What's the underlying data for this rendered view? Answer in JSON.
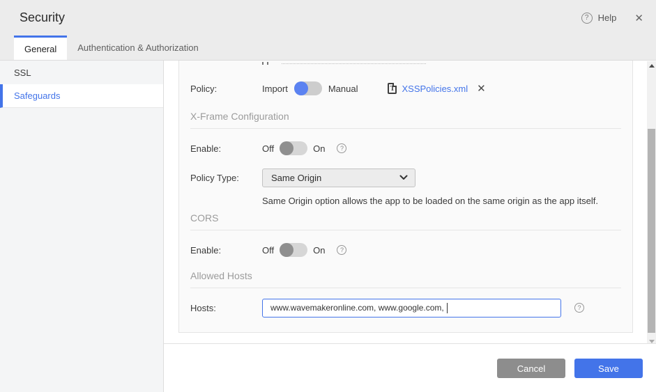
{
  "window": {
    "title": "Security",
    "help_label": "Help"
  },
  "icons": {
    "help_glyph": "?",
    "close_glyph": "✕",
    "remove_glyph": "✕",
    "file_glyph": "T",
    "caret": "|"
  },
  "tabs": [
    {
      "label": "General",
      "active": true
    },
    {
      "label": "Authentication & Authorization",
      "active": false
    }
  ],
  "sidebar": {
    "items": [
      {
        "label": "SSL",
        "selected": false
      },
      {
        "label": "Safeguards",
        "selected": true
      }
    ]
  },
  "form": {
    "policy": {
      "label": "Policy:",
      "import_label": "Import",
      "manual_label": "Manual",
      "selected": "Import",
      "file_name": "XSSPolicies.xml"
    },
    "xframe": {
      "title": "X-Frame Configuration",
      "enable": {
        "label": "Enable:",
        "off_label": "Off",
        "on_label": "On",
        "state": "Off"
      },
      "policy_type": {
        "label": "Policy Type:",
        "value": "Same Origin"
      },
      "helper_text": "Same Origin option allows the app to be loaded on the same origin as the app itself."
    },
    "cors": {
      "title": "CORS",
      "enable": {
        "label": "Enable:",
        "off_label": "Off",
        "on_label": "On",
        "state": "Off"
      }
    },
    "allowed_hosts": {
      "title": "Allowed Hosts",
      "hosts": {
        "label": "Hosts:",
        "value": "www.wavemakeronline.com, www.google.com, "
      }
    }
  },
  "footer": {
    "cancel_label": "Cancel",
    "save_label": "Save"
  },
  "colors": {
    "accent": "#4374e9",
    "toggle_on_knob": "#5b82f1",
    "toggle_off_knob": "#8f8f8f",
    "cancel_button": "#8d8d8d",
    "link": "#4374e9",
    "header_bg": "#ececec",
    "sidebar_bg": "#f4f5f6",
    "panel_bg": "#fafafa"
  }
}
